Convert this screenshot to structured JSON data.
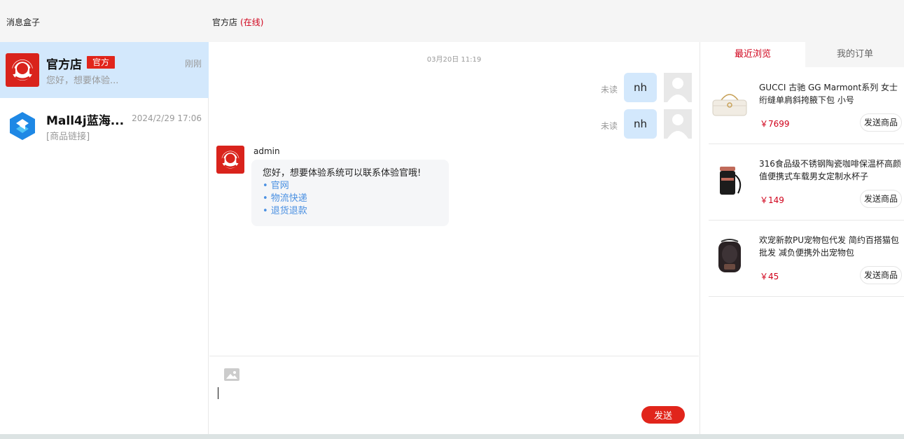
{
  "header": {
    "inbox_title": "消息盒子",
    "shop_name": "官方店",
    "online_status": "(在线)"
  },
  "conversations": [
    {
      "name": "官方店",
      "tag": "官方",
      "time": "刚刚",
      "preview": "您好，想要体验..."
    },
    {
      "name": "Mall4j蓝海...",
      "time": "2024/2/29 17:06",
      "preview": "[商品链接]"
    }
  ],
  "chat": {
    "datestamp": "03月20日 11:19",
    "sent_messages": [
      {
        "status": "未读",
        "text": "nh"
      },
      {
        "status": "未读",
        "text": "nh"
      }
    ],
    "received": {
      "sender": "admin",
      "text": "您好，想要体验系统可以联系体验官哦!",
      "links": [
        "• 官网",
        "• 物流快递",
        "• 退货退款"
      ]
    }
  },
  "composer": {
    "send_label": "发送"
  },
  "right_panel": {
    "tabs": [
      "最近浏览",
      "我的订单"
    ],
    "products": [
      {
        "title": "GUCCI 古驰 GG Marmont系列 女士绗缝单肩斜挎腋下包 小号",
        "price": "￥7699",
        "send_label": "发送商品"
      },
      {
        "title": "316食品级不锈钢陶瓷咖啡保温杯高颜值便携式车载男女定制水杯子",
        "price": "￥149",
        "send_label": "发送商品"
      },
      {
        "title": "欢宠新款PU宠物包代发 简约百搭猫包批发 减负便携外出宠物包",
        "price": "￥45",
        "send_label": "发送商品"
      }
    ]
  },
  "colors": {
    "accent_red": "#e1251b",
    "active_blue": "#d3e8fc",
    "link_blue": "#4a90e2"
  }
}
